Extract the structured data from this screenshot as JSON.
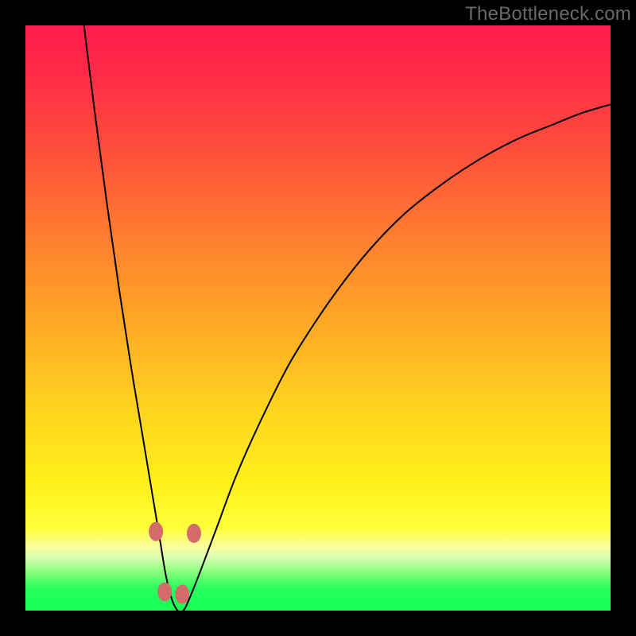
{
  "watermark": "TheBottleneck.com",
  "chart_data": {
    "type": "line",
    "title": "",
    "xlabel": "",
    "ylabel": "",
    "xlim": [
      0,
      100
    ],
    "ylim": [
      0,
      100
    ],
    "grid": false,
    "legend": false,
    "series": [
      {
        "name": "bottleneck-curve",
        "x": [
          10,
          12,
          14,
          16,
          18,
          20,
          21,
          22,
          23,
          24,
          25,
          26,
          27,
          28,
          30,
          33,
          36,
          40,
          45,
          50,
          55,
          60,
          65,
          70,
          75,
          80,
          85,
          90,
          95,
          100
        ],
        "y": [
          100,
          84,
          69,
          55,
          42,
          30,
          24,
          18,
          12,
          6,
          2,
          0,
          0,
          2,
          7,
          15,
          23,
          32,
          42,
          50,
          57,
          63,
          68,
          72,
          75.5,
          78.5,
          81,
          83,
          85,
          86.5
        ]
      }
    ],
    "markers": [
      {
        "x": 22.3,
        "y": 13.5
      },
      {
        "x": 23.8,
        "y": 3.2
      },
      {
        "x": 26.8,
        "y": 2.8
      },
      {
        "x": 28.8,
        "y": 13.2
      }
    ],
    "gradient_stops": [
      {
        "pos": 0.0,
        "color": "#ff1a4d"
      },
      {
        "pos": 0.35,
        "color": "#ff7a30"
      },
      {
        "pos": 0.65,
        "color": "#ffd21e"
      },
      {
        "pos": 0.88,
        "color": "#ffff3a"
      },
      {
        "pos": 0.95,
        "color": "#2aff60"
      },
      {
        "pos": 1.0,
        "color": "#18ff55"
      }
    ]
  }
}
